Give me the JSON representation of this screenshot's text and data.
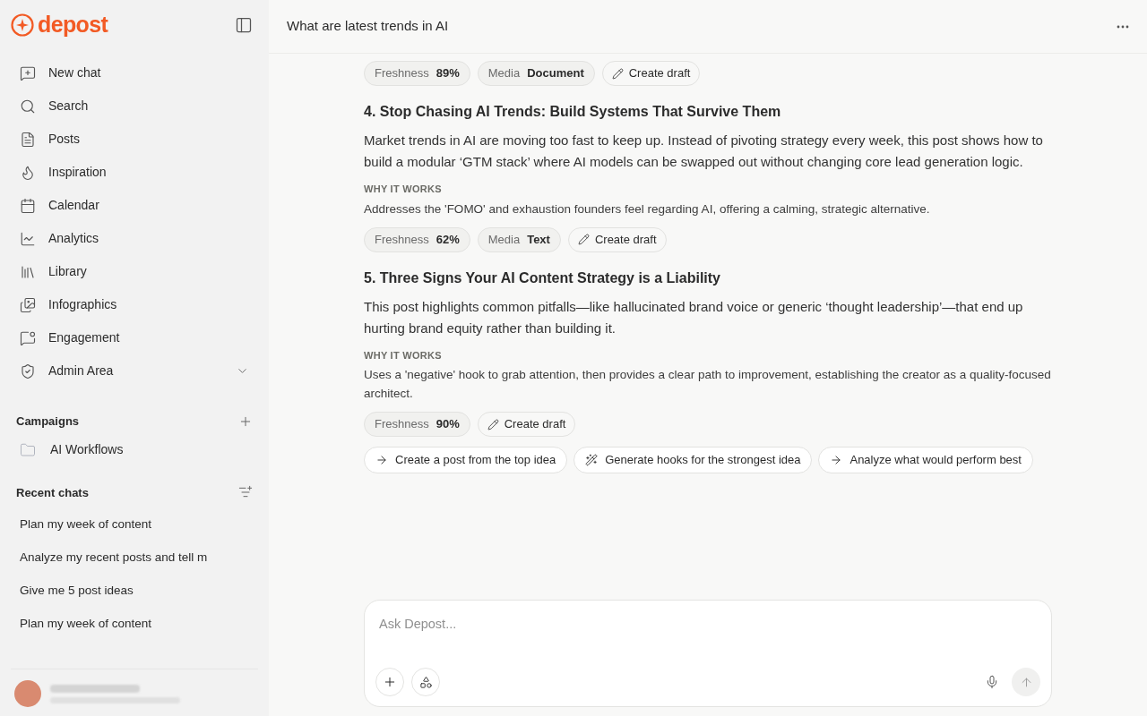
{
  "sidebar": {
    "logo": "depost",
    "nav": [
      {
        "label": "New chat"
      },
      {
        "label": "Search"
      },
      {
        "label": "Posts"
      },
      {
        "label": "Inspiration"
      },
      {
        "label": "Calendar"
      },
      {
        "label": "Analytics"
      },
      {
        "label": "Library"
      },
      {
        "label": "Infographics"
      },
      {
        "label": "Engagement"
      },
      {
        "label": "Admin Area",
        "expanded": false
      }
    ],
    "campaigns": {
      "title": "Campaigns",
      "items": [
        "AI Workflows"
      ]
    },
    "recent": {
      "title": "Recent chats",
      "items": [
        "Plan my week of content",
        "Analyze my recent posts and tell m",
        "Give me 5 post ideas",
        "Plan my week of content"
      ]
    }
  },
  "header": {
    "title": "What are latest trends in AI"
  },
  "ideas": [
    {
      "tags": [
        {
          "label": "Freshness",
          "value": "89%"
        },
        {
          "label": "Media",
          "value": "Document"
        }
      ],
      "action": "Create draft"
    },
    {
      "title": "4. Stop Chasing AI Trends: Build Systems That Survive Them",
      "body": "Market trends in AI are moving too fast to keep up. Instead of pivoting strategy every week, this post shows how to build a modular ‘GTM stack’ where AI models can be swapped out without changing core lead generation logic.",
      "why_label": "WHY IT WORKS",
      "why": "Addresses the 'FOMO' and exhaustion founders feel regarding AI, offering a calming, strategic alternative.",
      "tags": [
        {
          "label": "Freshness",
          "value": "62%"
        },
        {
          "label": "Media",
          "value": "Text"
        }
      ],
      "action": "Create draft"
    },
    {
      "title": "5. Three Signs Your AI Content Strategy is a Liability",
      "body": "This post highlights common pitfalls—like hallucinated brand voice or generic ‘thought leadership’—that end up hurting brand equity rather than building it.",
      "why_label": "WHY IT WORKS",
      "why": "Uses a 'negative' hook to grab attention, then provides a clear path to improvement, establishing the creator as a quality-focused architect.",
      "tags": [
        {
          "label": "Freshness",
          "value": "90%"
        }
      ],
      "action": "Create draft"
    }
  ],
  "suggestions": [
    {
      "label": "Create a post from the top idea",
      "kind": "arrow"
    },
    {
      "label": "Generate hooks for the strongest idea",
      "kind": "wand"
    },
    {
      "label": "Analyze what would perform best",
      "kind": "arrow"
    }
  ],
  "composer": {
    "placeholder": "Ask Depost..."
  }
}
